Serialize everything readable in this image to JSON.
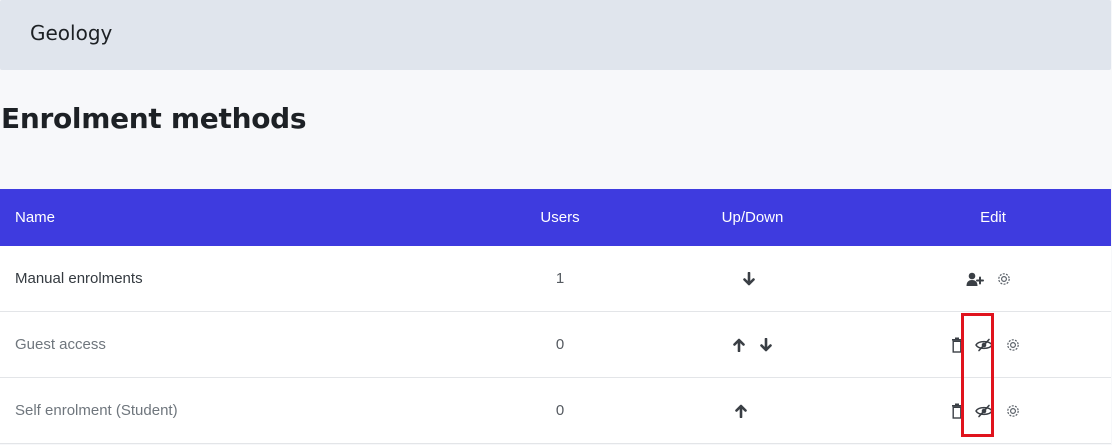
{
  "breadcrumb": {
    "course_title": "Geology"
  },
  "page": {
    "heading": "Enrolment methods"
  },
  "table": {
    "headers": {
      "name": "Name",
      "users": "Users",
      "updown": "Up/Down",
      "edit": "Edit"
    },
    "rows": [
      {
        "name": "Manual enrolments",
        "users": "1",
        "enabled": true,
        "updown": [
          "arrow-down-icon"
        ],
        "edit": [
          "enrol-users-icon",
          "settings-gear-icon"
        ]
      },
      {
        "name": "Guest access",
        "users": "0",
        "enabled": false,
        "updown": [
          "arrow-up-icon",
          "arrow-down-icon"
        ],
        "edit": [
          "delete-trash-icon",
          "eye-slash-icon",
          "settings-gear-icon"
        ]
      },
      {
        "name": "Self enrolment (Student)",
        "users": "0",
        "enabled": false,
        "updown": [
          "arrow-up-icon"
        ],
        "edit": [
          "delete-trash-icon",
          "eye-slash-icon",
          "settings-gear-icon"
        ]
      }
    ]
  },
  "colors": {
    "header_bg": "#3e3bdf",
    "breadcrumb_bg": "#e0e5ed",
    "highlight": "#e0131d"
  }
}
